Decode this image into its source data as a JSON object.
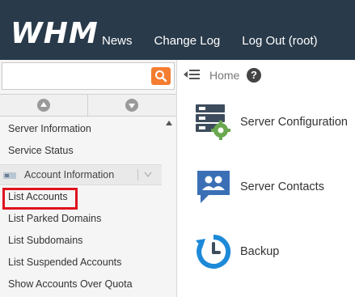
{
  "header": {
    "logo_text": "WHM",
    "nav": [
      "News",
      "Change Log",
      "Log Out (root)"
    ]
  },
  "sidebar": {
    "search": {
      "value": "",
      "placeholder": ""
    },
    "items_top": [
      "Server Information",
      "Service Status"
    ],
    "group_label": "Account Information",
    "group_items": [
      "List Accounts",
      "List Parked Domains",
      "List Subdomains",
      "List Suspended Accounts",
      "Show Accounts Over Quota"
    ],
    "selected_item": "List Accounts"
  },
  "breadcrumb": {
    "home": "Home",
    "help": "?"
  },
  "categories": [
    {
      "label": "Server Configuration",
      "icon": "server-config-icon"
    },
    {
      "label": "Server Contacts",
      "icon": "contacts-icon"
    },
    {
      "label": "Backup",
      "icon": "backup-icon"
    }
  ],
  "colors": {
    "header_bg": "#293a4a",
    "search_button": "#f47d31",
    "highlight_border": "#e0121f",
    "icon_dark": "#3d4c5c",
    "icon_green": "#6aa84f",
    "icon_blue": "#3a6fb5",
    "backup_blue": "#1c8ad8"
  }
}
